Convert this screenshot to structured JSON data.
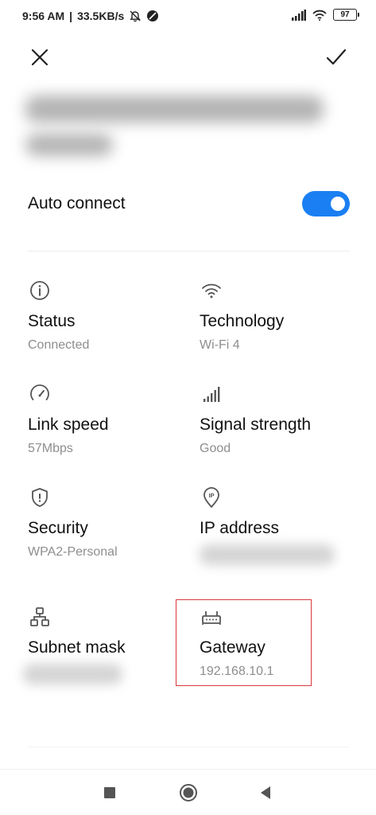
{
  "status_bar": {
    "time": "9:56 AM",
    "net_speed": "33.5KB/s",
    "battery": "97"
  },
  "top_bar": {
    "close_icon": "close-icon",
    "confirm_icon": "check-icon"
  },
  "auto_connect": {
    "label": "Auto connect",
    "enabled": true
  },
  "details": [
    {
      "icon": "info-icon",
      "title": "Status",
      "value": "Connected"
    },
    {
      "icon": "wifi-icon",
      "title": "Technology",
      "value": "Wi-Fi 4"
    },
    {
      "icon": "speedometer-icon",
      "title": "Link speed",
      "value": "57Mbps"
    },
    {
      "icon": "signal-bars-icon",
      "title": "Signal strength",
      "value": "Good"
    },
    {
      "icon": "shield-icon",
      "title": "Security",
      "value": "WPA2-Personal"
    },
    {
      "icon": "ip-pin-icon",
      "title": "IP address",
      "value": ""
    },
    {
      "icon": "network-tree-icon",
      "title": "Subnet mask",
      "value": ""
    },
    {
      "icon": "router-icon",
      "title": "Gateway",
      "value": "192.168.10.1"
    }
  ],
  "colors": {
    "accent": "#1a7ff2",
    "highlight": "#d9393c",
    "secondary_text": "#8e8e8e"
  }
}
